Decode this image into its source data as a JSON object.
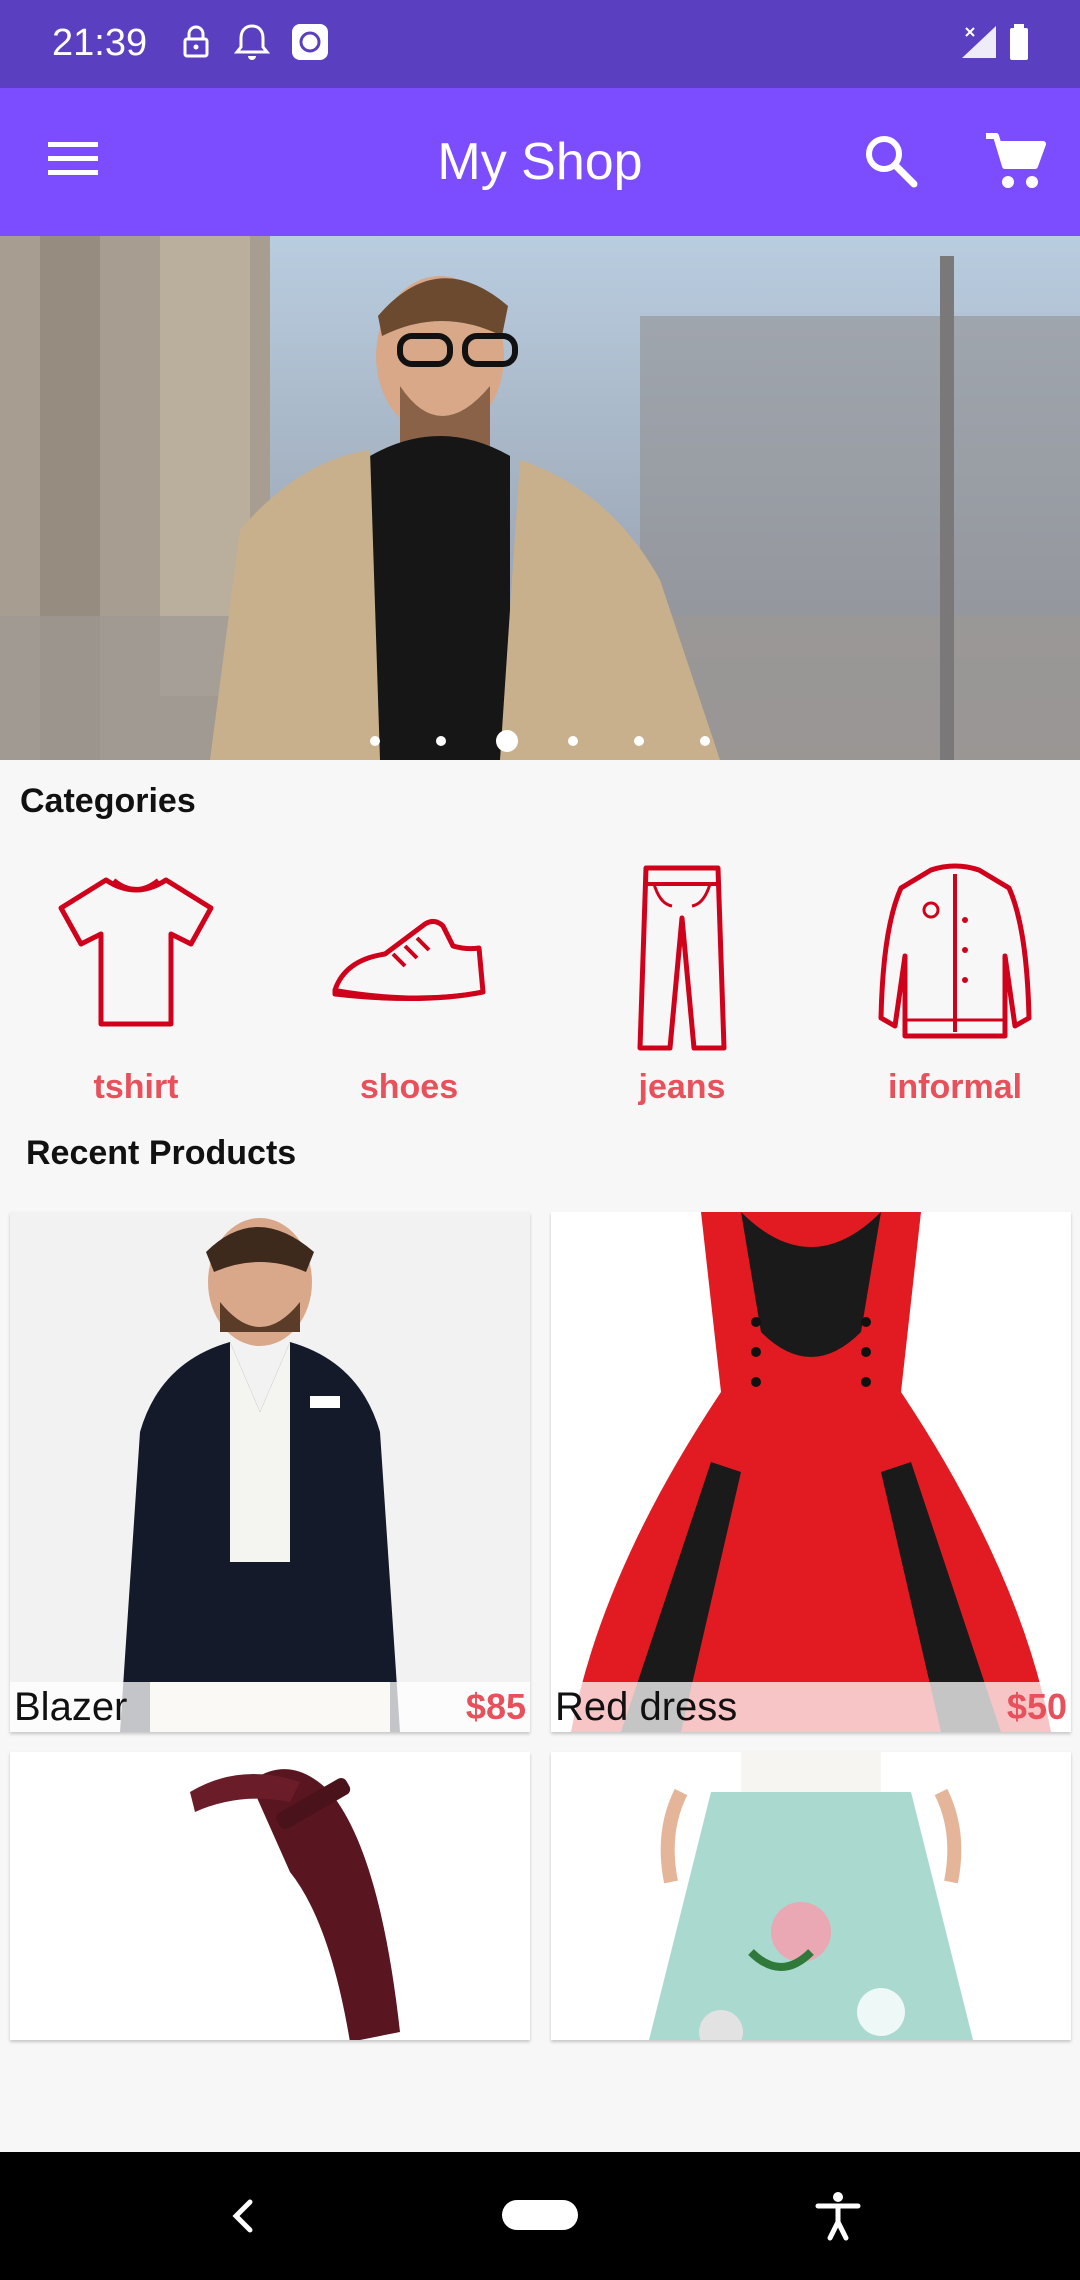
{
  "status_bar": {
    "time": "21:39",
    "icons": [
      "lock-icon",
      "notification-bell-icon",
      "camera-notification-icon",
      "signal-icon",
      "battery-icon"
    ]
  },
  "app_bar": {
    "title": "My Shop",
    "icons": [
      "menu-icon",
      "search-icon",
      "cart-icon"
    ],
    "color": "#7c4dff"
  },
  "carousel": {
    "slide_count": 6,
    "active_index": 2
  },
  "categories": {
    "heading": "Categories",
    "items": [
      {
        "label": "tshirt",
        "icon": "tshirt-icon"
      },
      {
        "label": "shoes",
        "icon": "shoe-icon"
      },
      {
        "label": "jeans",
        "icon": "jeans-icon"
      },
      {
        "label": "informal",
        "icon": "jacket-icon"
      }
    ],
    "accent": "#e8505b"
  },
  "recent_products": {
    "heading": "Recent Products",
    "items": [
      {
        "name": "Blazer",
        "price": "$85"
      },
      {
        "name": "Red dress",
        "price": "$50"
      },
      {
        "name": "",
        "price": ""
      },
      {
        "name": "",
        "price": ""
      }
    ]
  },
  "nav_bar": {
    "icons": [
      "back-icon",
      "home-pill-icon",
      "accessibility-icon"
    ]
  }
}
